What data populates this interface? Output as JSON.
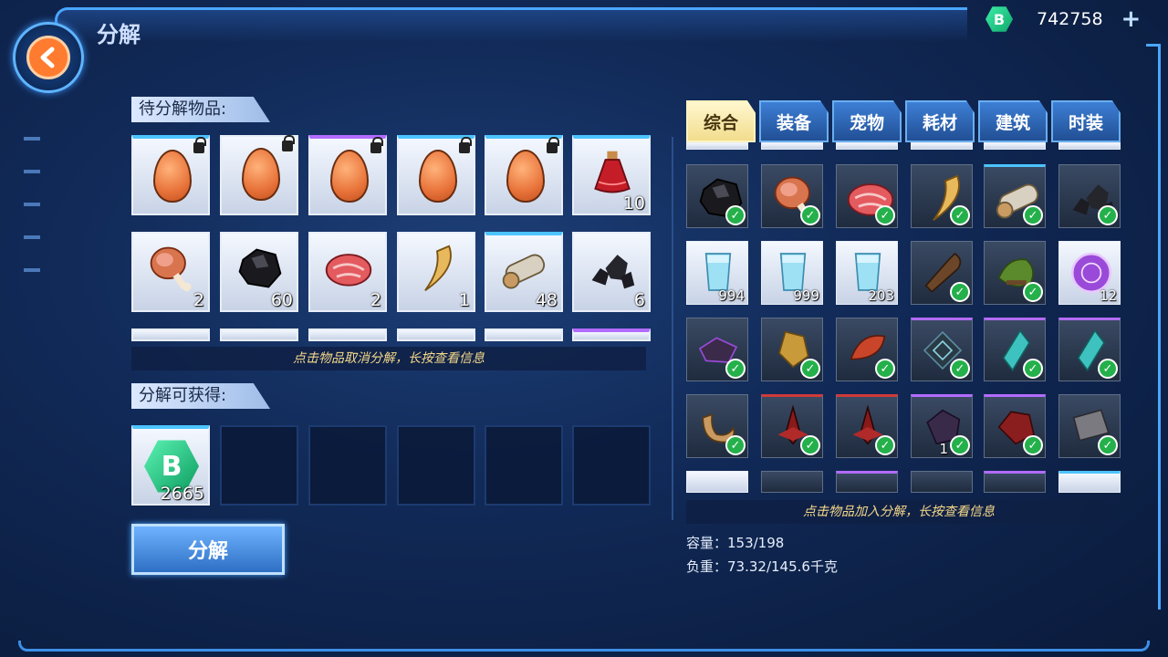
{
  "header": {
    "title": "分解",
    "currency_value": "742758",
    "currency_symbol": "B",
    "plus_label": "+"
  },
  "pending": {
    "label": "待分解物品:",
    "hint": "点击物品取消分解，长按查看信息",
    "items": [
      {
        "name": "egg",
        "count": "",
        "locked": true
      },
      {
        "name": "egg",
        "count": "",
        "locked": true
      },
      {
        "name": "egg",
        "count": "",
        "locked": true
      },
      {
        "name": "egg",
        "count": "",
        "locked": true
      },
      {
        "name": "egg",
        "count": "",
        "locked": true
      },
      {
        "name": "red-potion",
        "count": "10",
        "locked": false
      },
      {
        "name": "ham",
        "count": "2",
        "locked": false
      },
      {
        "name": "coal",
        "count": "60",
        "locked": false
      },
      {
        "name": "raw-meat",
        "count": "2",
        "locked": false
      },
      {
        "name": "tooth",
        "count": "1",
        "locked": false
      },
      {
        "name": "log",
        "count": "48",
        "locked": false
      },
      {
        "name": "ore-rocks",
        "count": "6",
        "locked": false
      }
    ]
  },
  "rewards": {
    "label": "分解可获得:",
    "items": [
      {
        "name": "b-coin",
        "count": "2665"
      }
    ]
  },
  "decompose_button": "分解",
  "tabs": [
    "综合",
    "装备",
    "宠物",
    "耗材",
    "建筑",
    "时装"
  ],
  "inventory": {
    "hint": "点击物品加入分解，长按查看信息",
    "rows": [
      [
        {
          "icon": "coal",
          "count": "",
          "checked": true,
          "light": false
        },
        {
          "icon": "ham",
          "count": "",
          "checked": true,
          "light": false
        },
        {
          "icon": "raw-meat",
          "count": "",
          "checked": true,
          "light": false
        },
        {
          "icon": "tooth",
          "count": "",
          "checked": true,
          "light": false
        },
        {
          "icon": "log",
          "count": "",
          "checked": true,
          "light": false
        },
        {
          "icon": "ore-rocks",
          "count": "",
          "checked": true,
          "light": false
        }
      ],
      [
        {
          "icon": "water-glass",
          "count": "994",
          "checked": false,
          "light": true
        },
        {
          "icon": "water-glass",
          "count": "999",
          "checked": false,
          "light": true
        },
        {
          "icon": "water-glass",
          "count": "203",
          "checked": false,
          "light": true
        },
        {
          "icon": "club",
          "count": "",
          "checked": true,
          "light": false
        },
        {
          "icon": "moss-rock",
          "count": "",
          "checked": true,
          "light": false
        },
        {
          "icon": "purple-medal",
          "count": "12",
          "checked": false,
          "light": true
        }
      ],
      [
        {
          "icon": "purple-scrap",
          "count": "",
          "checked": true,
          "light": false
        },
        {
          "icon": "gold-shard",
          "count": "",
          "checked": true,
          "light": false
        },
        {
          "icon": "red-leaf",
          "count": "",
          "checked": true,
          "light": false
        },
        {
          "icon": "rune-stone",
          "count": "",
          "checked": true,
          "light": false
        },
        {
          "icon": "crystal",
          "count": "",
          "checked": true,
          "light": false
        },
        {
          "icon": "crystal",
          "count": "",
          "checked": true,
          "light": false
        }
      ],
      [
        {
          "icon": "horn",
          "count": "",
          "checked": true,
          "light": false
        },
        {
          "icon": "red-spike",
          "count": "",
          "checked": true,
          "light": false
        },
        {
          "icon": "red-spike",
          "count": "",
          "checked": true,
          "light": false
        },
        {
          "icon": "dark-ore",
          "count": "1",
          "checked": true,
          "light": false
        },
        {
          "icon": "red-ore",
          "count": "",
          "checked": true,
          "light": false
        },
        {
          "icon": "scrap-metal",
          "count": "",
          "checked": true,
          "light": false
        }
      ]
    ]
  },
  "stats": {
    "capacity": "容量：153/198",
    "weight": "负重：73.32/145.6千克"
  }
}
